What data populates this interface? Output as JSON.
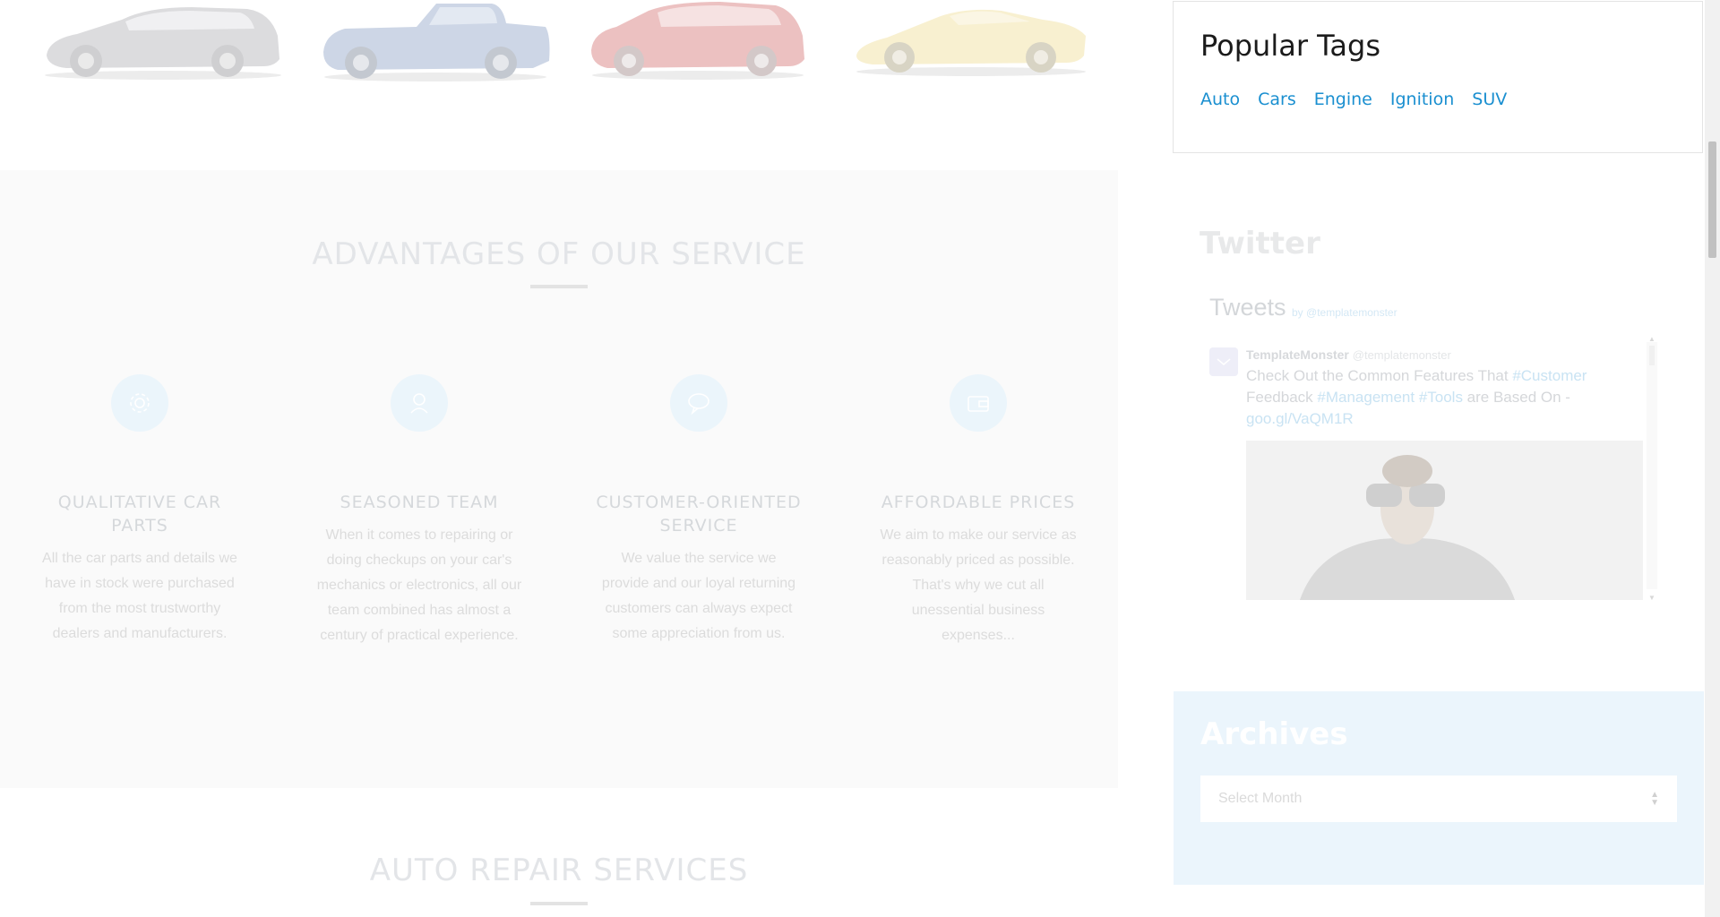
{
  "cars": [
    {
      "name": "silver-wagon",
      "color": "#c6c6c8"
    },
    {
      "name": "blue-pickup",
      "color": "#6a86b8"
    },
    {
      "name": "red-suv",
      "color": "#c83a3a"
    },
    {
      "name": "yellow-supercar",
      "color": "#f0e4a8"
    }
  ],
  "advantages": {
    "title": "ADVANTAGES OF OUR SERVICE",
    "features": [
      {
        "icon": "gear-icon",
        "title": "QUALITATIVE CAR PARTS",
        "text": "All the car parts and details we have in stock were purchased from the most trustworthy dealers and manufacturers."
      },
      {
        "icon": "user-icon",
        "title": "SEASONED TEAM",
        "text": "When it comes to repairing or doing checkups on your car's mechanics or electronics, all our team combined has almost a century of practical experience."
      },
      {
        "icon": "chat-bubble-icon",
        "title": "CUSTOMER-ORIENTED SERVICE",
        "text": "We value the service we provide and our loyal returning customers can always expect some appreciation from us."
      },
      {
        "icon": "wallet-icon",
        "title": "AFFORDABLE PRICES",
        "text": "We aim to make our service as reasonably priced as possible. That's why we cut all unessential business expenses..."
      }
    ]
  },
  "services": {
    "title": "AUTO REPAIR SERVICES"
  },
  "sidebar": {
    "popular_tags": {
      "title": "Popular Tags",
      "tags": [
        "Auto",
        "Cars",
        "Engine",
        "Ignition",
        "SUV"
      ]
    },
    "twitter": {
      "title": "Twitter",
      "timeline": {
        "heading": "Tweets",
        "by_prefix": "by",
        "by_handle": "@templatemonster",
        "tweet": {
          "author": "TemplateMonster",
          "handle": "@templatemonster",
          "text_1": "Check Out the Common Features That ",
          "hashtag_1": "#Customer",
          "text_2": " Feedback ",
          "hashtag_2": "#Management",
          "text_3": " ",
          "hashtag_3": "#Tools",
          "text_4": " are Based On - ",
          "link": "goo.gl/VaQM1R"
        }
      }
    },
    "archives": {
      "title": "Archives",
      "select_placeholder": "Select Month"
    }
  },
  "colors": {
    "tag_link": "#1a8fd0",
    "archives_bg": "#ebf5fc",
    "icon_circle": "#ebf5fb"
  }
}
